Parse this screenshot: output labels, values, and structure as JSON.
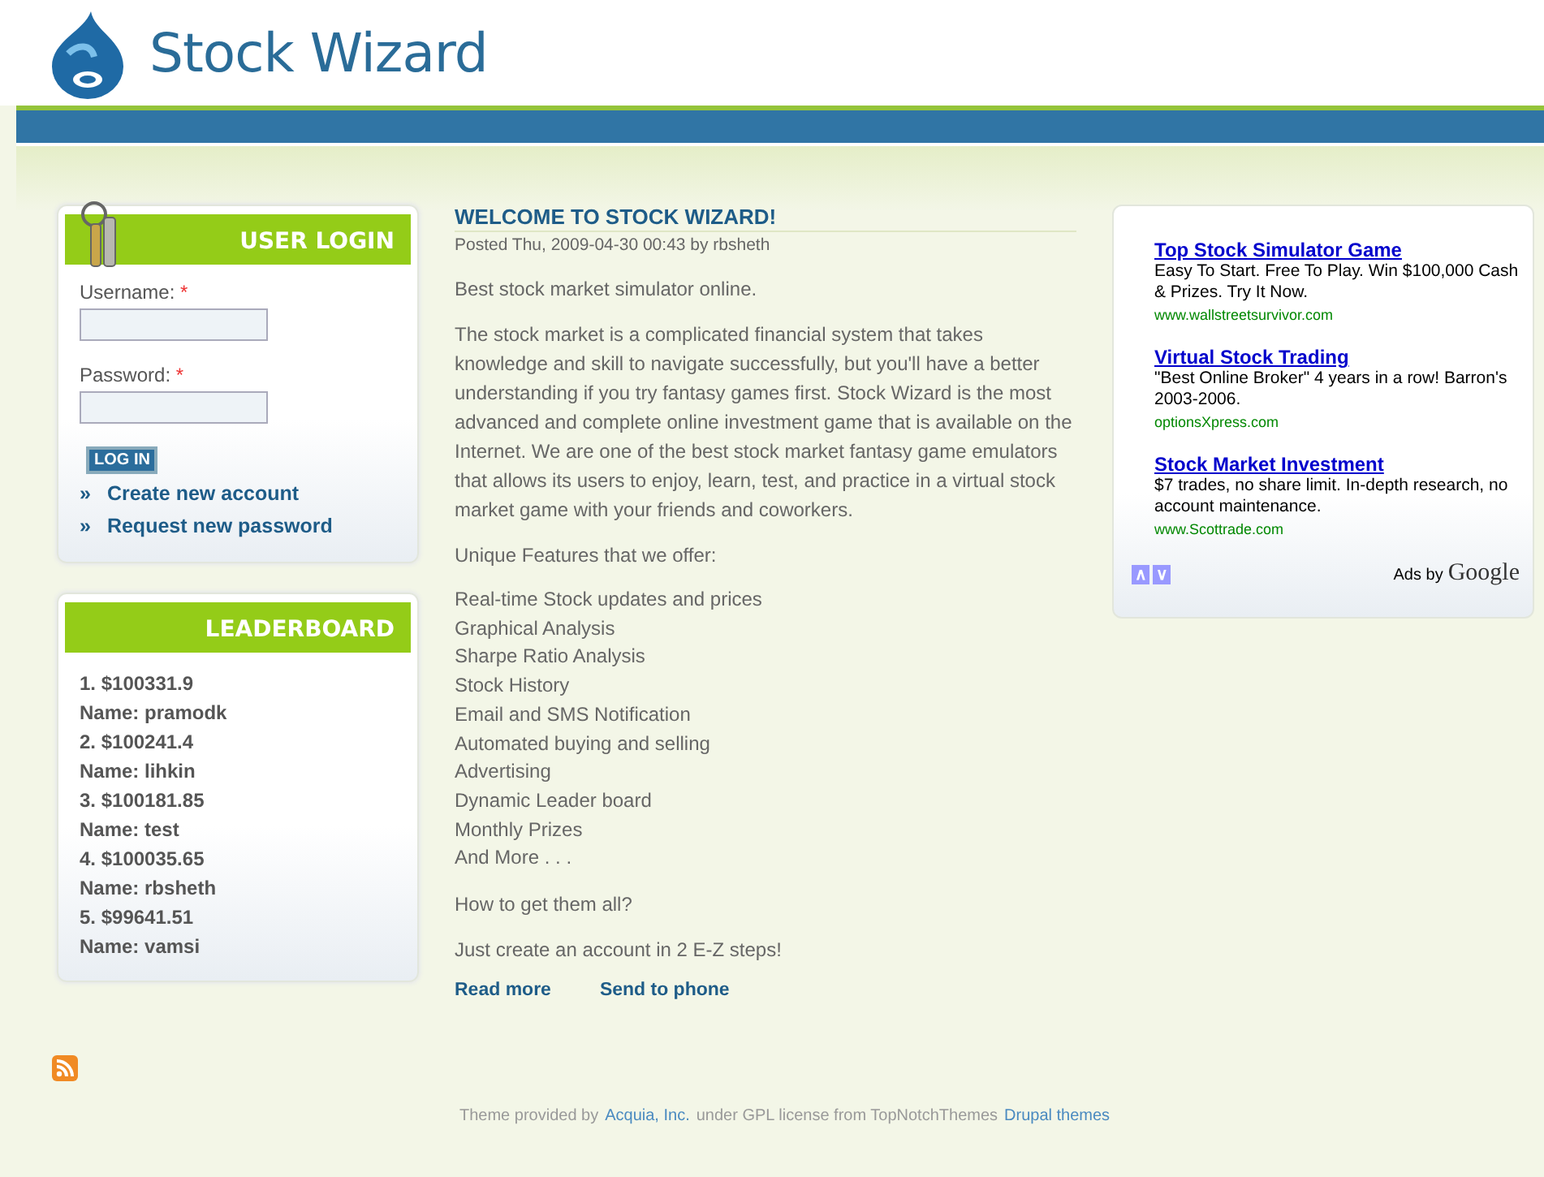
{
  "site": {
    "name": "Stock Wizard"
  },
  "login": {
    "title": "USER LOGIN",
    "username_label": "Username:",
    "password_label": "Password:",
    "required_mark": "*",
    "button": "LOG IN",
    "links": [
      "Create new account",
      "Request new password"
    ],
    "link_bullet": "»"
  },
  "leaderboard": {
    "title": "LEADERBOARD",
    "entries": [
      {
        "score": "1. $100331.9",
        "name": "Name: pramodk"
      },
      {
        "score": "2. $100241.4",
        "name": "Name: lihkin"
      },
      {
        "score": "3. $100181.85",
        "name": "Name: test"
      },
      {
        "score": "4. $100035.65",
        "name": "Name: rbsheth"
      },
      {
        "score": "5. $99641.51",
        "name": "Name: vamsi"
      }
    ]
  },
  "article": {
    "title": "WELCOME TO STOCK WIZARD!",
    "meta": "Posted Thu, 2009-04-30 00:43 by rbsheth",
    "paragraphs": [
      "Best stock market simulator online.",
      "The stock market is a complicated financial system that takes knowledge and skill to navigate successfully, but you'll have a better understanding if you try fantasy games first. Stock Wizard is the most advanced and complete online investment game that is available on the Internet. We are one of the best stock market fantasy game emulators that allows its users to enjoy, learn, test, and practice in a virtual stock market game with your friends and coworkers.",
      "Unique Features that we offer:"
    ],
    "features": [
      "Real-time Stock updates and prices",
      "Graphical Analysis",
      "Sharpe Ratio Analysis",
      "Stock History",
      "Email and SMS Notification",
      "Automated buying and selling",
      "Advertising",
      "Dynamic Leader board",
      "Monthly Prizes",
      "And More . . ."
    ],
    "closing": [
      "How to get them all?",
      "Just create an account in 2 E-Z steps!"
    ],
    "links": [
      "Read more",
      "Send to phone"
    ]
  },
  "ads": {
    "items": [
      {
        "title": "Top Stock Simulator Game",
        "text": "Easy To Start. Free To Play. Win $100,000 Cash & Prizes. Try It Now.",
        "url": "www.wallstreetsurvivor.com"
      },
      {
        "title": "Virtual Stock Trading",
        "text": "\"Best Online Broker\" 4 years in a row! Barron's 2003-2006.",
        "url": "optionsXpress.com"
      },
      {
        "title": "Stock Market Investment",
        "text": "$7 trades, no share limit. In-depth research, no account maintenance.",
        "url": "www.Scottrade.com"
      }
    ],
    "nav": [
      "∧",
      "∨"
    ],
    "ads_by": "Ads by",
    "brand": "Google"
  },
  "footer": {
    "parts": [
      {
        "kind": "text",
        "text": "Theme provided by"
      },
      {
        "kind": "link",
        "text": "Acquia, Inc."
      },
      {
        "kind": "text",
        "text": "under GPL license from TopNotchThemes"
      },
      {
        "kind": "link",
        "text": "Drupal themes"
      }
    ]
  }
}
